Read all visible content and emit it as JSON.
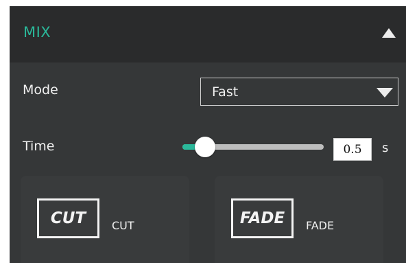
{
  "panel": {
    "title": "MIX",
    "collapse_icon": "chevron-up-icon"
  },
  "mode": {
    "label": "Mode",
    "selected": "Fast",
    "dropdown_icon": "caret-down-icon"
  },
  "time": {
    "label": "Time",
    "value": "0.5",
    "unit": "s",
    "slider_fraction": 0.16
  },
  "transitions": [
    {
      "badge": "CUT",
      "label": "CUT"
    },
    {
      "badge": "FADE",
      "label": "FADE"
    }
  ],
  "colors": {
    "accent": "#2ab89a",
    "panel_bg": "#353738",
    "header_bg": "#2a2b2c"
  }
}
